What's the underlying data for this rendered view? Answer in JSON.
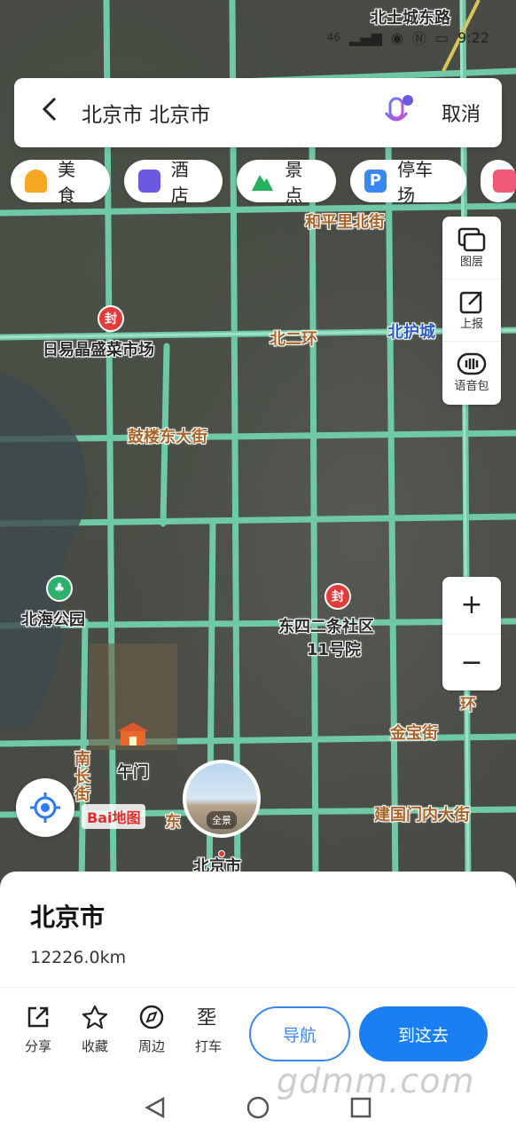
{
  "status_bar": {
    "time": "9:22",
    "signal": "46"
  },
  "search": {
    "query": "北京市 北京市",
    "cancel_label": "取消"
  },
  "chips": [
    {
      "label": "美食",
      "icon": "food-icon",
      "color": "#f5a623"
    },
    {
      "label": "酒店",
      "icon": "hotel-icon",
      "color": "#6a5ae0"
    },
    {
      "label": "景点",
      "icon": "scenic-icon",
      "color": "#27b25f"
    },
    {
      "label": "停车场",
      "icon": "parking-icon",
      "color": "#3a86f5"
    }
  ],
  "tools": [
    {
      "label": "图层",
      "icon": "layers-icon"
    },
    {
      "label": "上报",
      "icon": "report-icon"
    },
    {
      "label": "语音包",
      "icon": "voice-pack-icon"
    }
  ],
  "zoom": {
    "in": "+",
    "out": "−"
  },
  "map_labels": {
    "top_street": "北土城东路",
    "heping": "和平里北街",
    "market": "日易晶盛菜市场",
    "beierhuan": "北二环",
    "beihucheng": "北护城",
    "gulou": "鼓楼东大街",
    "beihai": "北海公园",
    "dongsi": "东四二条社区",
    "dongsi2": "11号院",
    "wumen": "午门",
    "jinbao": "金宝街",
    "jianguo": "建国门内大街",
    "nanchang": "南长街",
    "huan": "环",
    "beijing": "北京市",
    "dongfu": "东",
    "pin_mark": "封"
  },
  "pano": {
    "label": "全景"
  },
  "logo": {
    "text": "Bai地图"
  },
  "sheet": {
    "title": "北京市",
    "distance": "12226.0km",
    "actions": [
      {
        "label": "分享",
        "icon": "share-icon"
      },
      {
        "label": "收藏",
        "icon": "star-icon"
      },
      {
        "label": "周边",
        "icon": "compass-icon"
      },
      {
        "label": "打车",
        "icon": "taxi-icon"
      }
    ],
    "nav_label": "导航",
    "go_label": "到这去"
  },
  "watermark": "gdmm.com",
  "colors": {
    "road": "#7fd0b0",
    "accent": "#1a7ff5"
  }
}
